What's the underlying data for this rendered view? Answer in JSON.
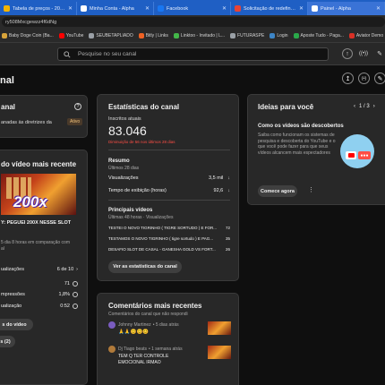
{
  "browser": {
    "tabs": [
      {
        "label": "Tabela de preços - 20º S...",
        "color": "#f4b400"
      },
      {
        "label": "Minha Conta - Alpha",
        "color": "#ffffff"
      },
      {
        "label": "Facebook",
        "color": "#1877f2"
      },
      {
        "label": "Solicitação de redefiniçã...",
        "color": "#ea4335"
      },
      {
        "label": "Painel - Alpha",
        "color": "#ffffff"
      }
    ],
    "url": "ry508Mxcgewzz4f6dNg",
    "bookmarks": [
      {
        "label": "Baby Doge Coin (Ba...",
        "color": "#d7a33a"
      },
      {
        "label": "YouTube",
        "color": "#ff0000"
      },
      {
        "label": "SEUBETAPLIADO",
        "color": "#9aa0a6"
      },
      {
        "label": "Bitly | Links",
        "color": "#ee6123"
      },
      {
        "label": "Linktoo - Invitado | L...",
        "color": "#43b649"
      },
      {
        "label": "FUTURASPE",
        "color": "#9aa0a6"
      },
      {
        "label": "Login",
        "color": "#3d85c6"
      },
      {
        "label": "Aposte Tudo - Paga...",
        "color": "#2aa84a"
      },
      {
        "label": "Aviator Demo",
        "color": "#d93025"
      }
    ]
  },
  "header": {
    "search_placeholder": "Pesquise no seu canal",
    "page_title": "nal"
  },
  "left_col": {
    "canal_title": "anal",
    "guidelines_text": "anadas às diretrizes da",
    "badge": "Ativo",
    "recent_title": "do vídeo mais recente",
    "thumb_text": "200x",
    "video_title": "Y: PEGUEI 200X NESSE SLOT",
    "compare_text": "5 dia 8 horas em comparação com",
    "compare_text2": "al",
    "stats": [
      {
        "label": "ualizações",
        "value": "6 de 10",
        "arrow": "›"
      },
      {
        "label": "",
        "value": "71",
        "arrow": ""
      },
      {
        "label": "mpressões",
        "value": "1,8%",
        "arrow": ""
      },
      {
        "label": "ualização",
        "value": "0:52",
        "arrow": ""
      }
    ],
    "btn_video": "s do vídeo",
    "btn_comments": "s (2)"
  },
  "stats_card": {
    "title": "Estatísticas do canal",
    "subs_label": "Inscritos atuais",
    "subs_value": "83.046",
    "subs_change": "Diminuição de 56 nos últimos 28 dias",
    "summary_title": "Resumo",
    "summary_sub": "Últimos 28 dias",
    "summary_rows": [
      {
        "label": "Visualizações",
        "value": "3,5 mil",
        "arrow": "↓"
      },
      {
        "label": "Tempo de exibição (horas)",
        "value": "92,6",
        "arrow": "↓"
      }
    ],
    "top_title": "Principais vídeos",
    "top_sub": "Últimas 48 horas · Visualizações",
    "top_videos": [
      {
        "title": "TESTEI O NOVO TIGRINHO ( TIGRE SORTUDO ) E FOR...",
        "value": "72"
      },
      {
        "title": "TESTAMOS O NOVO TIGRINHO ( tigre sortudo ) E PAG...",
        "value": "35"
      },
      {
        "title": "DESAFIO SLOT DE CASAL - GANESHA GOLD VS FORT...",
        "value": "26"
      }
    ],
    "btn": "Ver as estatísticas do canal"
  },
  "comments_card": {
    "title": "Comentários mais recentes",
    "sub": "Comentários do canal que não respondi",
    "items": [
      {
        "author": "Johnny Martinez",
        "time": "• 5 dias atrás",
        "text": "🙏🙏😊😊😊",
        "avatar": "#7a5cc0"
      },
      {
        "author": "Dj Tiago beats",
        "time": "• 1 semana atrás",
        "text": "TEM Q TER CONTROLE EMOCIONAL IRMAO",
        "avatar": "#b07a3a"
      }
    ]
  },
  "ideas_card": {
    "title": "Ideias para você",
    "pager": "1 / 3",
    "idea_title": "Como os vídeos são descobertos",
    "idea_text": "Saiba como funcionam os sistemas de pesquisa e descoberta do YouTube e o que você pode fazer para que seus vídeos alcancem mais espectadores",
    "btn": "Comece agora"
  },
  "colors": {
    "accent_red": "#ff4e45",
    "brand": "#ff0000",
    "illustration": "#8fd0f0"
  }
}
